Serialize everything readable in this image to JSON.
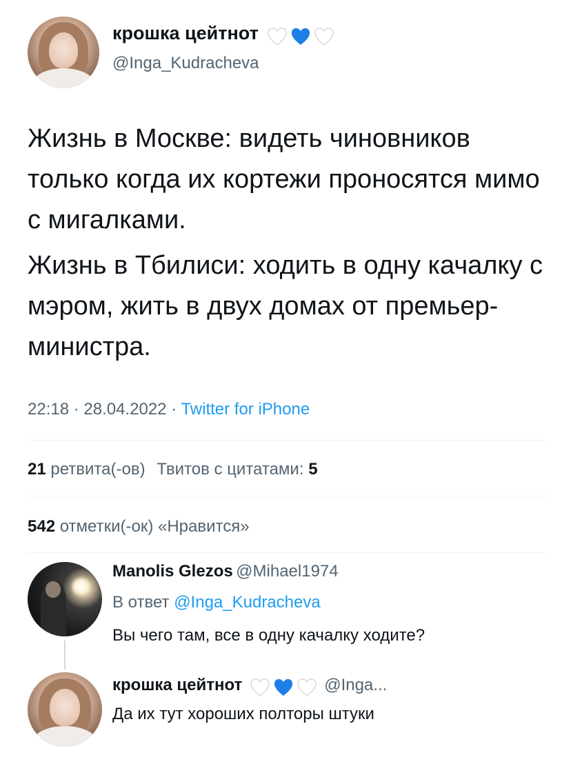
{
  "tweet": {
    "author_name": "крошка цейтнот",
    "author_emoji": [
      "white-heart",
      "blue-heart",
      "white-heart"
    ],
    "author_handle": "@Inga_Kudracheva",
    "paragraph_1": "Жизнь в Москве: видеть чиновников только когда их кортежи проносятся мимо с мигалками.",
    "paragraph_2": "Жизнь в Тбилиси: ходить в одну качалку с мэром, жить в двух домах от премьер-министра.",
    "time": "22:18",
    "date": "28.04.2022",
    "separator": "·",
    "source": "Twitter for iPhone",
    "retweets_count": "21",
    "retweets_label": "ретвита(-ов)",
    "quotes_label": "Твитов с цитатами:",
    "quotes_count": "5",
    "likes_count": "542",
    "likes_label": "отметки(-ок) «Нравится»"
  },
  "reply_1": {
    "author_name": "Manolis Glezos",
    "author_handle": "@Mihael1974",
    "reply_to_label": "В ответ",
    "reply_to_handle": "@Inga_Kudracheva",
    "text": "Вы чего там, все в одну качалку ходите?"
  },
  "reply_2": {
    "author_name": "крошка цейтнот",
    "author_emoji": [
      "white-heart",
      "blue-heart",
      "white-heart"
    ],
    "author_handle": "@Inga...",
    "text": "Да их тут хороших полторы штуки"
  },
  "colors": {
    "link": "#1d9bf0",
    "secondary_text": "#536471",
    "primary_text": "#0f1419",
    "blue_heart": "#1d7fe6",
    "white_heart_outline": "#d9d9d9"
  }
}
